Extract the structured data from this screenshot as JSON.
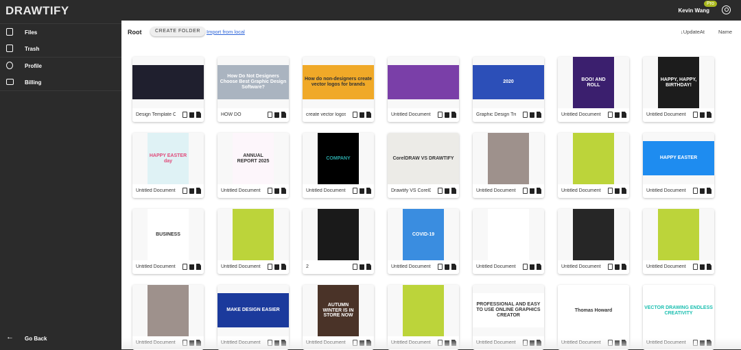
{
  "app": {
    "logo": "DRAWTIFY",
    "user_name": "Kevin Wang",
    "badge": "Pro"
  },
  "sidebar": {
    "items": [
      {
        "label": "Files",
        "icon": "file-icon"
      },
      {
        "label": "Trash",
        "icon": "trash-icon"
      },
      {
        "label": "Profile",
        "icon": "account-circle-icon"
      },
      {
        "label": "Billing",
        "icon": "billing-icon"
      }
    ],
    "go_back": "Go Back"
  },
  "toolbar": {
    "breadcrumb": "Root",
    "create_folder": "CREATE FOLDER",
    "import": "Import from local",
    "sort_update": "↓UpdateAt",
    "sort_name": "Name"
  },
  "cards": [
    {
      "name": "Design Template C",
      "bg": "#1f1f2e",
      "shape": "land",
      "text": ""
    },
    {
      "name": "HOW DO",
      "bg": "#aab4c0",
      "shape": "land",
      "text": "How Do Not Designers Choose Best Graphic Design Software?"
    },
    {
      "name": "create vector logos",
      "bg": "#f0a928",
      "shape": "land",
      "text": "How do non-designers create vector logos for brands"
    },
    {
      "name": "Untitled Document",
      "bg": "#7a3fa8",
      "shape": "land",
      "text": ""
    },
    {
      "name": "Graphic Design Tre",
      "bg": "#2c4fb8",
      "shape": "land",
      "text": "2020"
    },
    {
      "name": "Untitled Document",
      "bg": "#3b1f6e",
      "shape": "port",
      "text": "BOO! AND ROLL"
    },
    {
      "name": "Untitled Document",
      "bg": "#1c1c1c",
      "shape": "port",
      "text": "HAPPY, HAPPY, BIRTHDAY!"
    },
    {
      "name": "Untitled Document",
      "bg": "#dff2f5",
      "shape": "port",
      "text": "HAPPY EASTER day"
    },
    {
      "name": "Untitled Document",
      "bg": "#fdf6fb",
      "shape": "port",
      "text": "ANNUAL REPORT 2025"
    },
    {
      "name": "Untitled Document",
      "bg": "#000000",
      "shape": "port",
      "text": "COMPANY"
    },
    {
      "name": "Drawtify VS CorelD",
      "bg": "#ecebe7",
      "shape": "full",
      "text": "CorelDRAW VS DRAWTIFY"
    },
    {
      "name": "Untitled Document",
      "bg": "#9e918c",
      "shape": "port",
      "text": ""
    },
    {
      "name": "Untitled Document",
      "bg": "#bcd43a",
      "shape": "port",
      "text": ""
    },
    {
      "name": "Untitled Document",
      "bg": "#1e8cf0",
      "shape": "land",
      "text": "HAPPY EASTER"
    },
    {
      "name": "Untitled Document",
      "bg": "#ffffff",
      "shape": "port",
      "text": "BUSINESS"
    },
    {
      "name": "Untitled Document",
      "bg": "#bcd43a",
      "shape": "port",
      "text": ""
    },
    {
      "name": "2",
      "bg": "#1a1a1a",
      "shape": "port",
      "text": ""
    },
    {
      "name": "Untitled Document",
      "bg": "#3a8de0",
      "shape": "port",
      "text": "COVID-19"
    },
    {
      "name": "Untitled Document",
      "bg": "#ffffff",
      "shape": "port",
      "text": ""
    },
    {
      "name": "Untitled Document",
      "bg": "#262626",
      "shape": "port",
      "text": ""
    },
    {
      "name": "Untitled Document",
      "bg": "#bcd43a",
      "shape": "port",
      "text": ""
    },
    {
      "name": "Untitled Document",
      "bg": "#9e918c",
      "shape": "port",
      "text": ""
    },
    {
      "name": "Untitled Document",
      "bg": "#1b3a9c",
      "shape": "land",
      "text": "MAKE DESIGN EASIER"
    },
    {
      "name": "Untitled Document",
      "bg": "#4a3328",
      "shape": "port",
      "text": "AUTUMN WINTER IS IN STORE NOW"
    },
    {
      "name": "Untitled Document",
      "bg": "#bcd43a",
      "shape": "port",
      "text": ""
    },
    {
      "name": "Untitled Document",
      "bg": "#ffffff",
      "shape": "land",
      "text": "PROFESSIONAL AND EASY TO USE ONLINE GRAPHICS CREATOR"
    },
    {
      "name": "Untitled Document",
      "bg": "#ffffff",
      "shape": "full",
      "text": "Thomas Howard"
    },
    {
      "name": "Untitled Document",
      "bg": "#ffffff",
      "shape": "full",
      "text": "VECTOR DRAWING ENDLESS CREATIVITY"
    }
  ]
}
